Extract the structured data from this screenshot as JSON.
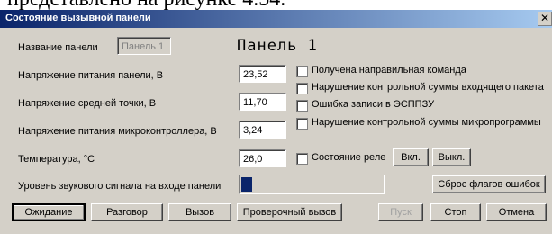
{
  "doc": {
    "caption_line": "представлено на рисунке 4.54."
  },
  "window": {
    "title": "Состояние вызывной панели",
    "close_glyph": "✕"
  },
  "panel": {
    "name_label": "Название панели",
    "name_value": "Панель 1",
    "display_name": "Панель  1"
  },
  "measurements": [
    {
      "label": "Напряжение питания панели, В",
      "value": "23,52"
    },
    {
      "label": "Напряжение средней точки, В",
      "value": "11,70"
    },
    {
      "label": "Напряжение питания микроконтроллера, В",
      "value": "3,24"
    },
    {
      "label": "Температура, °С",
      "value": "26,0"
    }
  ],
  "flags": [
    {
      "label": "Получена направильная команда",
      "checked": false
    },
    {
      "label": "Нарушение контрольной суммы входящего пакета",
      "checked": false
    },
    {
      "label": "Ошибка записи в ЭСППЗУ",
      "checked": false
    },
    {
      "label": "Нарушение контрольной суммы микропрограммы",
      "checked": false
    }
  ],
  "relay": {
    "label": "Состояние реле",
    "on_label": "Вкл.",
    "off_label": "Выкл."
  },
  "sound": {
    "label": "Уровень звукового сигнала на входе панели",
    "level_percent": 8
  },
  "reset_flags_label": "Сброс флагов ошибок",
  "buttons": {
    "wait": "Ожидание",
    "talk": "Разговор",
    "call": "Вызов",
    "test_call": "Проверочный вызов",
    "start": "Пуск",
    "stop": "Стоп",
    "cancel": "Отмена"
  }
}
